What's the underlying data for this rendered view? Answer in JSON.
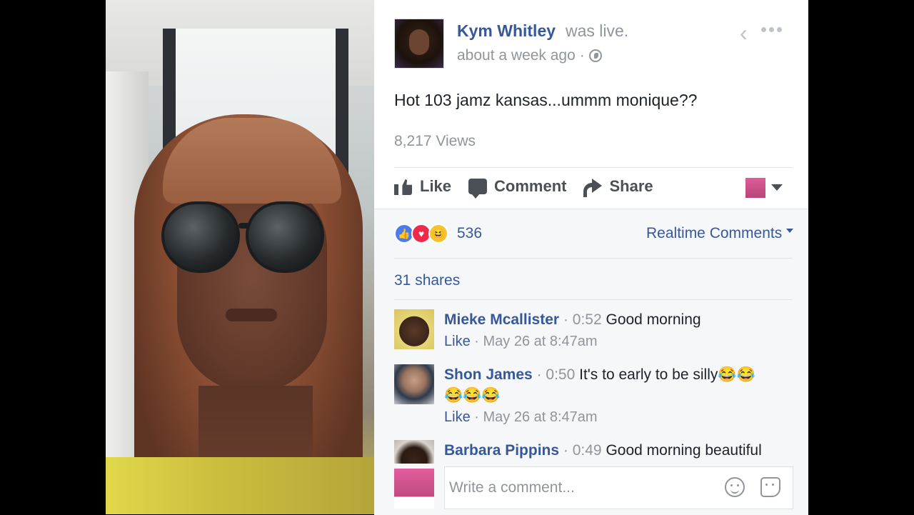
{
  "post": {
    "author": "Kym Whitley",
    "status": "was live.",
    "time": "about a week ago",
    "separator": "·",
    "message": "Hot 103 jamz kansas...ummm monique??",
    "views": "8,217 Views"
  },
  "actions": {
    "like": "Like",
    "comment": "Comment",
    "share": "Share"
  },
  "engagement": {
    "reaction_count": "536",
    "realtime_label": "Realtime Comments",
    "shares": "31 shares"
  },
  "comments": [
    {
      "name": "Mieke Mcallister",
      "time": "0:52",
      "text": "Good morning",
      "like": "Like",
      "date": "May 26 at 8:47am"
    },
    {
      "name": "Shon James",
      "time": "0:50",
      "text": "It's to early to be silly😂😂",
      "text2": "😂😂😂",
      "like": "Like",
      "date": "May 26 at 8:47am"
    },
    {
      "name": "Barbara Pippins",
      "time": "0:49",
      "text": "Good morning beautiful"
    }
  ],
  "composer": {
    "placeholder": "Write a comment..."
  },
  "colors": {
    "link": "#365899",
    "muted": "#90949c",
    "like_blue": "#4a7cf0",
    "love_red": "#f0284a",
    "haha_yellow": "#f7c22e"
  },
  "icons": {
    "reactions": [
      "like-icon",
      "love-icon",
      "haha-icon"
    ],
    "action_icons": [
      "thumbs-up-icon",
      "speech-bubble-icon",
      "share-arrow-icon"
    ],
    "composer_icons": [
      "emoji-icon",
      "sticker-icon"
    ]
  }
}
